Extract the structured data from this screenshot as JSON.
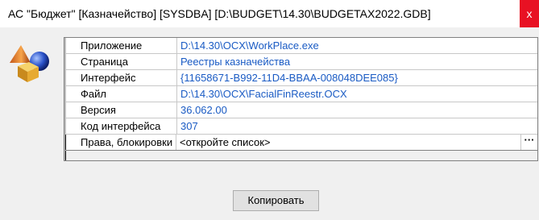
{
  "window": {
    "title": "АС \"Бюджет\" [Казначейство] [SYSDBA] [D:\\BUDGET\\14.30\\BUDGETAX2022.GDB]",
    "close_label": "x"
  },
  "properties": [
    {
      "label": "Приложение",
      "value": "D:\\14.30\\OCX\\WorkPlace.exe"
    },
    {
      "label": "Страница",
      "value": "Реестры казначейства"
    },
    {
      "label": "Интерфейс",
      "value": "{11658671-B992-11D4-BBAA-008048DEE085}"
    },
    {
      "label": "Файл",
      "value": "D:\\14.30\\OCX\\FacialFinReestr.OCX"
    },
    {
      "label": "Версия",
      "value": "36.062.00"
    },
    {
      "label": "Код интерфейса",
      "value": "307"
    },
    {
      "label": "Права, блокировки",
      "value": "<откройте список>",
      "button": "···"
    }
  ],
  "buttons": {
    "copy": "Копировать"
  },
  "icons": {
    "app": "app-shapes-icon",
    "close": "close-icon"
  },
  "colors": {
    "value_text": "#1a5bc4",
    "close_button": "#e81123"
  }
}
